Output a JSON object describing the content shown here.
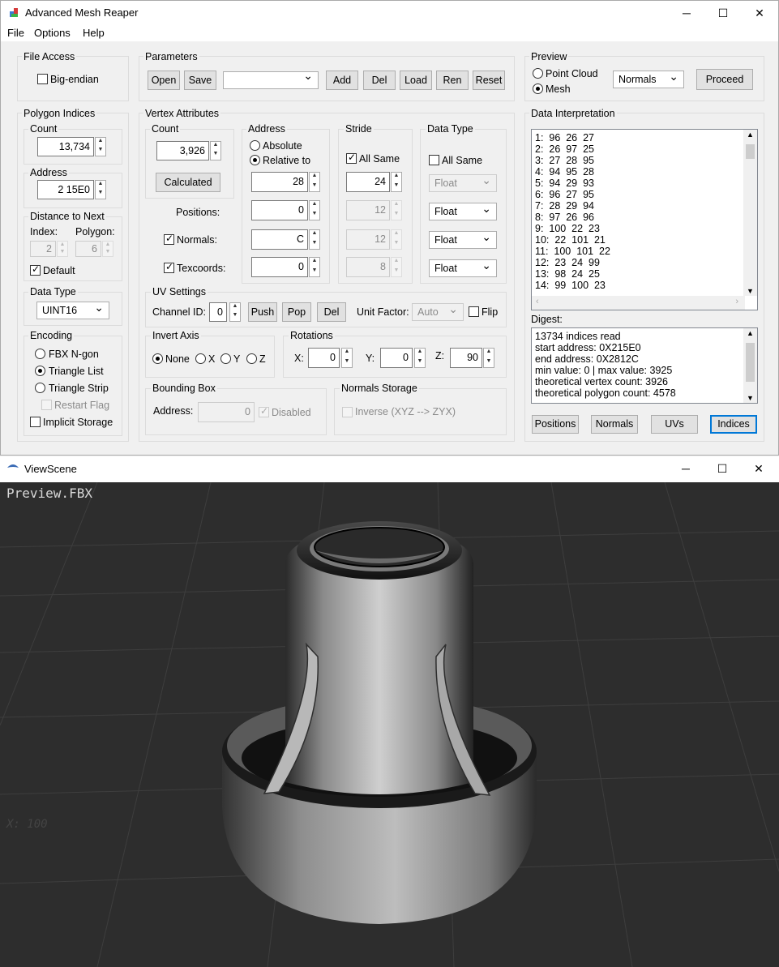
{
  "app": {
    "title": "Advanced Mesh Reaper",
    "menu": [
      "File",
      "Options",
      "Help"
    ],
    "window_controls": {
      "minimize": "─",
      "maximize": "☐",
      "close": "✕"
    }
  },
  "file_access": {
    "label": "File Access",
    "big_endian": {
      "label": "Big-endian",
      "checked": false
    }
  },
  "parameters": {
    "label": "Parameters",
    "buttons": [
      "Open",
      "Save",
      "Add",
      "Del",
      "Load",
      "Ren",
      "Reset"
    ],
    "combo_value": ""
  },
  "preview": {
    "label": "Preview",
    "point_cloud": "Point Cloud",
    "mesh": "Mesh",
    "selected": "Mesh",
    "mode_combo": "Normals",
    "proceed": "Proceed"
  },
  "polygon_indices": {
    "label": "Polygon Indices",
    "count_label": "Count",
    "count_value": "13,734",
    "address_label": "Address",
    "address_value": "2 15E0",
    "distance_label": "Distance to Next",
    "index_label": "Index:",
    "polygon_label": "Polygon:",
    "index_value": "2",
    "polygon_value": "6",
    "default_label": "Default",
    "data_type_label": "Data Type",
    "data_type_value": "UINT16",
    "encoding_label": "Encoding",
    "encodings": [
      "FBX N-gon",
      "Triangle List",
      "Triangle Strip"
    ],
    "selected_encoding": "Triangle List",
    "restart_flag": "Restart Flag",
    "implicit_storage": "Implicit Storage"
  },
  "vertex_attributes": {
    "label": "Vertex Attributes",
    "count_label": "Count",
    "count_value": "3,926",
    "calculated": "Calculated",
    "positions": "Positions:",
    "normals": "Normals:",
    "texcoords": "Texcoords:",
    "address_label": "Address",
    "absolute": "Absolute",
    "relative_to": "Relative to",
    "address_values": [
      "28",
      "0",
      "C",
      "0"
    ],
    "stride_label": "Stride",
    "all_same": "All Same",
    "stride_values": [
      "24",
      "12",
      "12",
      "8"
    ],
    "data_type_label": "Data Type",
    "data_type_all_same": "All Same",
    "data_types": [
      "Float",
      "Float",
      "Float",
      "Float"
    ]
  },
  "uv_settings": {
    "label": "UV Settings",
    "channel_label": "Channel ID:",
    "channel_value": "0",
    "push": "Push",
    "pop": "Pop",
    "del": "Del",
    "unit_factor_label": "Unit Factor:",
    "unit_factor_value": "Auto",
    "flip": "Flip"
  },
  "invert_axis": {
    "label": "Invert Axis",
    "options": [
      "None",
      "X",
      "Y",
      "Z"
    ],
    "selected": "None"
  },
  "rotations": {
    "label": "Rotations",
    "x_label": "X:",
    "y_label": "Y:",
    "z_label": "Z:",
    "x": "0",
    "y": "0",
    "z": "90"
  },
  "bounding_box": {
    "label": "Bounding Box",
    "address_label": "Address:",
    "address_value": "0",
    "disabled": "Disabled"
  },
  "normals_storage": {
    "label": "Normals Storage",
    "inverse": "Inverse (XYZ --> ZYX)"
  },
  "data_interpretation": {
    "label": "Data Interpretation",
    "lines": [
      "1:  96  26  27",
      "2:  26  97  25",
      "3:  27  28  95",
      "4:  94  95  28",
      "5:  94  29  93",
      "6:  96  27  95",
      "7:  28  29  94",
      "8:  97  26  96",
      "9:  100  22  23",
      "10:  22  101  21",
      "11:  100  101  22",
      "12:  23  24  99",
      "13:  98  24  25",
      "14:  99  100  23"
    ]
  },
  "digest": {
    "label": "Digest:",
    "lines": [
      "13734 indices read",
      "start address: 0X215E0",
      "end address: 0X2812C",
      "min value: 0 | max value: 3925",
      "theoretical vertex count: 3926",
      "theoretical polygon count: 4578"
    ]
  },
  "bottom_tabs": [
    "Positions",
    "Normals",
    "UVs",
    "Indices"
  ],
  "active_tab": "Indices",
  "viewer": {
    "title": "ViewScene",
    "overlay": "Preview.FBX",
    "axis_hint": "X:  100"
  },
  "colors": {
    "accent": "#0078d7",
    "viewport_bg": "#2d2d2d",
    "mesh": "#9a9a9a"
  }
}
